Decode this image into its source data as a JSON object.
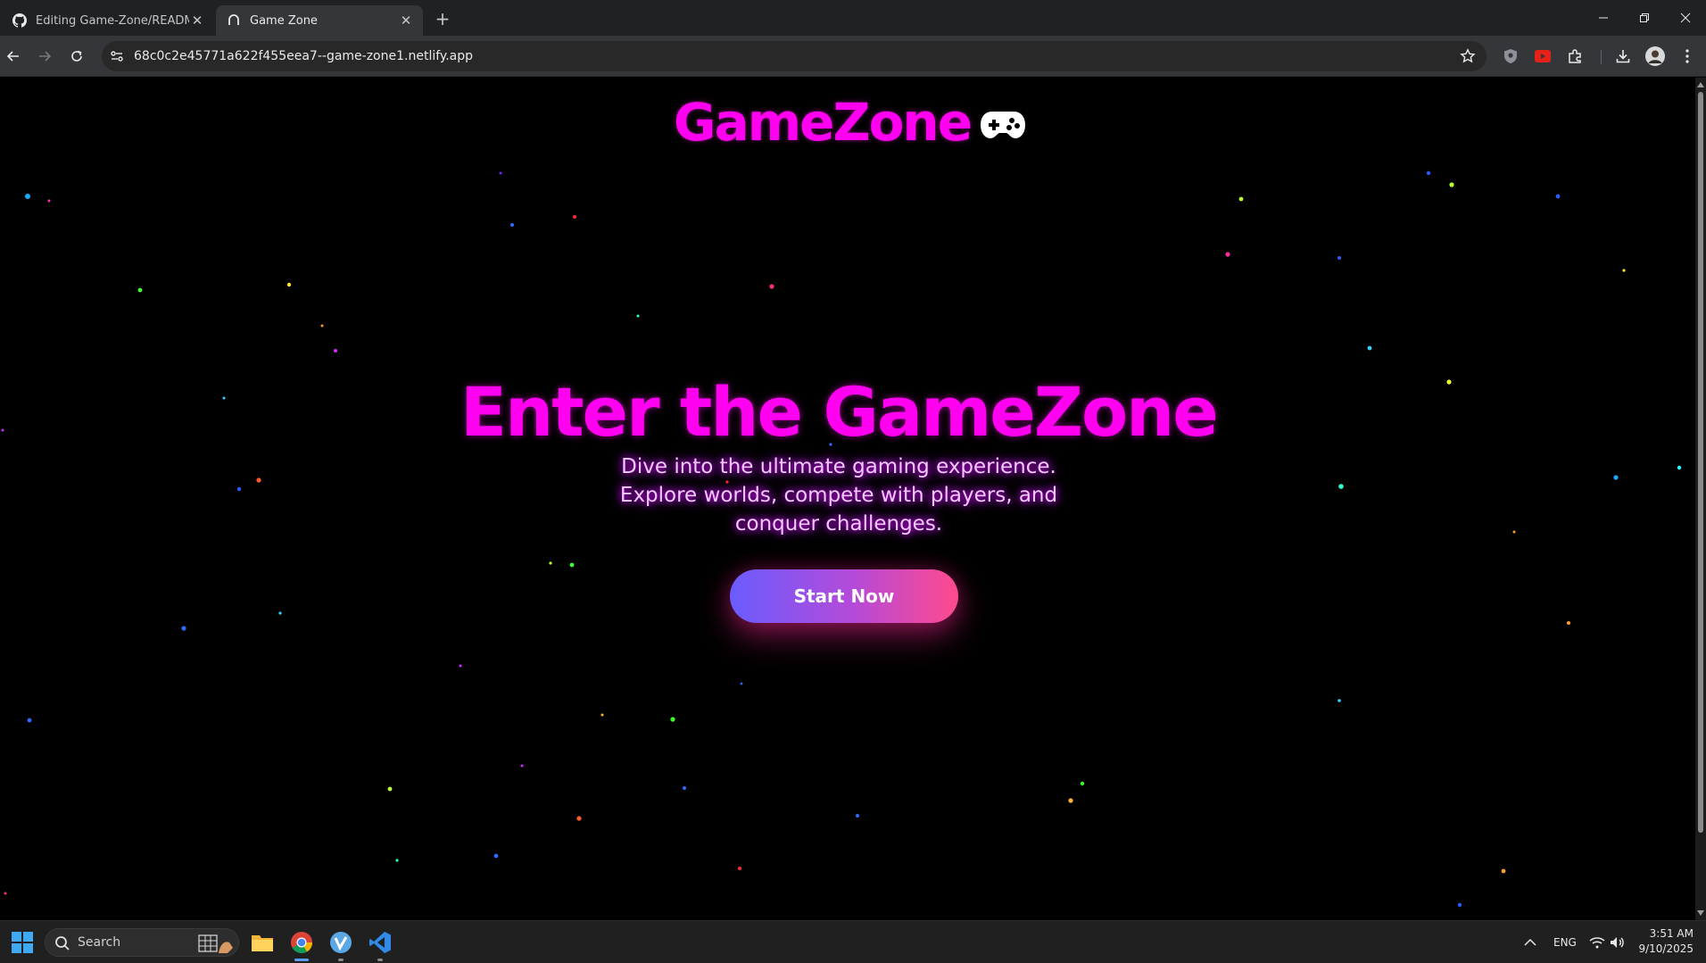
{
  "browser": {
    "tabs": [
      {
        "title": "Editing Game-Zone/README.m",
        "icon": "github-icon",
        "active": false
      },
      {
        "title": "Game Zone",
        "icon": "netlify-icon",
        "active": true
      }
    ],
    "url": "68c0c2e45771a622f455eea7--game-zone1.netlify.app"
  },
  "page": {
    "logo_text": "GameZone",
    "logo_icon": "gamepad-icon",
    "hero_title": "Enter the GameZone",
    "hero_subtitle": "Dive into the ultimate gaming experience. Explore worlds, compete with players, and conquer challenges.",
    "cta_label": "Start Now",
    "colors": {
      "accent": "#ff00f0",
      "background": "#000000",
      "button_gradient_start": "#6a5cff",
      "button_gradient_end": "#ff4a8d"
    }
  },
  "taskbar": {
    "search_placeholder": "Search",
    "language": "ENG",
    "time": "3:51 AM",
    "date": "9/10/2025"
  }
}
